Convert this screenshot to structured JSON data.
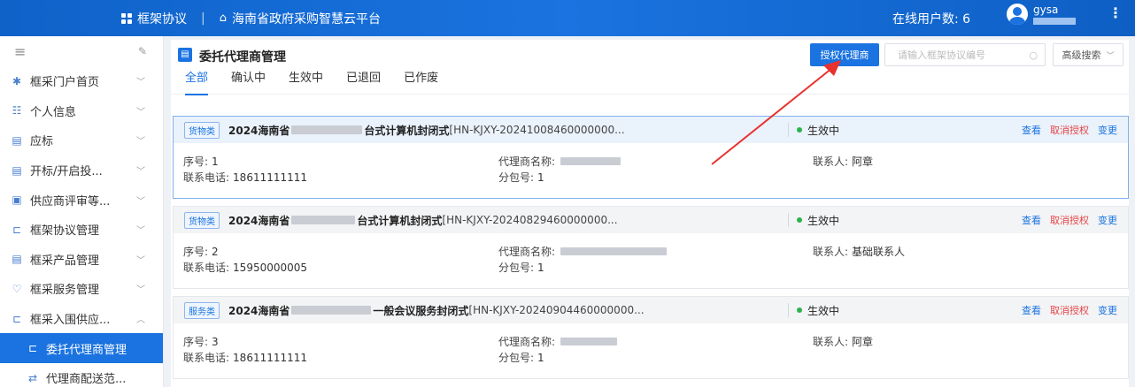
{
  "topbar": {
    "app_name": "框架协议",
    "separator": "|",
    "platform_name": "海南省政府采购智慧云平台",
    "online_users": "在线用户数: 6",
    "username": "gysa",
    "more_label": "⋮"
  },
  "sidebar": {
    "menu_icon": "≡",
    "pin_icon": "📌",
    "items": [
      {
        "label": "框采门户首页",
        "icon": "grid-icon"
      },
      {
        "label": "个人信息",
        "icon": "user-card-icon"
      },
      {
        "label": "应标",
        "icon": "doc-icon"
      },
      {
        "label": "开标/开启投...",
        "icon": "doc-open-icon"
      },
      {
        "label": "供应商评审等...",
        "icon": "review-icon"
      },
      {
        "label": "框架协议管理",
        "icon": "agreement-icon"
      },
      {
        "label": "框采产品管理",
        "icon": "product-icon"
      },
      {
        "label": "框采服务管理",
        "icon": "service-icon"
      },
      {
        "label": "框采入围供应...",
        "icon": "supplier-icon"
      },
      {
        "label": "委托代理商管理",
        "icon": "agent-icon"
      },
      {
        "label": "代理商配送范...",
        "icon": "delivery-icon"
      }
    ]
  },
  "main": {
    "title": "委托代理商管理",
    "auth_button": "授权代理商",
    "search_placeholder": "请输入框架协议编号",
    "advanced_search": "高级搜索",
    "tabs": [
      "全部",
      "确认中",
      "生效中",
      "已退回",
      "已作废"
    ],
    "field_labels": {
      "seq": "序号:",
      "phone": "联系电话:",
      "agent": "代理商名称:",
      "package": "分包号:",
      "contact": "联系人:"
    },
    "actions": {
      "view": "查看",
      "cancel": "取消授权",
      "change": "变更"
    },
    "cards": [
      {
        "tag": "货物类",
        "title_prefix": "2024海南省",
        "title_suffix": "台式计算机封闭式",
        "code": "[HN-KJXY-20241008460000000...",
        "status": "生效中",
        "seq": "1",
        "phone": "18611111111",
        "agent_partial": "",
        "package": "1",
        "contact": "阿章"
      },
      {
        "tag": "货物类",
        "title_prefix": "2024海南省",
        "title_suffix": "台式计算机封闭式",
        "code": "[HN-KJXY-20240829460000000...",
        "status": "生效中",
        "seq": "2",
        "phone": "15950000005",
        "agent_partial": "",
        "package": "1",
        "contact": "基础联系人"
      },
      {
        "tag": "服务类",
        "title_prefix": "2024海南省",
        "title_suffix": "一般会议服务封闭式",
        "code": "[HN-KJXY-20240904460000000...",
        "status": "生效中",
        "seq": "3",
        "phone": "18611111111",
        "agent_partial": "",
        "package": "1",
        "contact": "阿章"
      }
    ]
  },
  "colors": {
    "primary": "#1a73e0",
    "danger": "#e64545",
    "success": "#2bb24c",
    "annotation_arrow": "#e8322e"
  }
}
